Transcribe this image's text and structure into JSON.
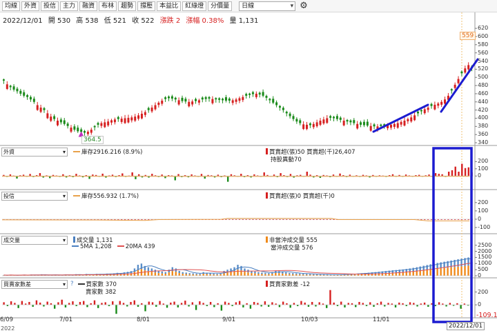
{
  "toolbar": {
    "buttons": [
      "均線",
      "外資",
      "投信",
      "主力",
      "融資",
      "布林",
      "趨勢",
      "撐壓",
      "本益比",
      "紅綠燈",
      "分價量"
    ],
    "period": "日線"
  },
  "quote": {
    "date": "2022/12/01",
    "open": "開 530",
    "high": "高 538",
    "low": "低 521",
    "close": "收 522",
    "change": "漲跌 2",
    "change_pct": "漲幅 0.38%",
    "volume": "量 1,131"
  },
  "colors": {
    "up": "#d62020",
    "down": "#1a8a1a",
    "accent_blue": "#1c1cd0",
    "ma": "#e8a14a"
  },
  "panels": {
    "foreign": {
      "select": "外資",
      "legend_hold": "庫存2916.216 (8.9%)",
      "legend_net": "買賣超(張)50 買賣超(千)26,407",
      "legend_sub": "持股異動70"
    },
    "trust": {
      "select": "投信",
      "legend_hold": "庫存556.932 (1.7%)",
      "legend_net": "買賣超(張)0 買賣超(千)0"
    },
    "volume": {
      "select": "成交量",
      "legend_vol": "成交量 1,131",
      "legend_ma5": "5MA 1,208",
      "legend_ma20": "20MA 439",
      "legend_day": "非當沖成交量 555",
      "legend_dt": "當沖成交量 576"
    },
    "brokers": {
      "select": "買賣家數差",
      "help": "?",
      "legend_buyers": "買家數 370",
      "legend_sellers": "賣家數 382",
      "legend_diff": "買賣家數差 -12",
      "last_value": "-109.1"
    }
  },
  "annotations": {
    "low_label": "364.5",
    "high_label": "559",
    "date_badge": "2022/12/01"
  },
  "x_ticks": [
    "6/09",
    "7/01",
    "8/01",
    "9/01",
    "10/03",
    "11/01"
  ],
  "x_year": "2022",
  "chart_data": [
    {
      "type": "candlestick",
      "title": "",
      "ylim": [
        335,
        632
      ],
      "yticks": [
        340,
        360,
        380,
        400,
        420,
        440,
        460,
        480,
        500,
        520,
        540,
        560,
        580,
        600,
        620
      ],
      "low": 364.5,
      "high": 559,
      "close_path": [
        492,
        483,
        476,
        470,
        466,
        460,
        455,
        452,
        446,
        440,
        432,
        426,
        420,
        412,
        404,
        398,
        394,
        390,
        386,
        381,
        377,
        372,
        368,
        366,
        364.5,
        367,
        372,
        378,
        384,
        388,
        390,
        392,
        395,
        397,
        398,
        399,
        400,
        401,
        402,
        404,
        407,
        411,
        415,
        420,
        426,
        432,
        438,
        443,
        447,
        449,
        448,
        446,
        444,
        442,
        441,
        440,
        441,
        442,
        444,
        446,
        447,
        448,
        447,
        446,
        445,
        444,
        443,
        443,
        444,
        446,
        449,
        452,
        455,
        457,
        459,
        460,
        458,
        455,
        450,
        444,
        438,
        432,
        426,
        420,
        412,
        405,
        398,
        392,
        388,
        385,
        384,
        383,
        386,
        390,
        394,
        397,
        400,
        401,
        400,
        398,
        396,
        394,
        392,
        390,
        388,
        386,
        384,
        383,
        382,
        381,
        380,
        380,
        381,
        382,
        383,
        384,
        386,
        388,
        391,
        394,
        398,
        402,
        407,
        412,
        417,
        422,
        426,
        430,
        433,
        436,
        440,
        446,
        455,
        468,
        482,
        496,
        510,
        522,
        530,
        522
      ]
    },
    {
      "type": "bar",
      "title": "外資",
      "yticks": [
        200,
        100,
        0
      ],
      "ylim": [
        -160,
        280
      ],
      "values": [
        15,
        -12,
        22,
        6,
        -35,
        10,
        18,
        -8,
        28,
        -14,
        12,
        40,
        -22,
        9,
        -30,
        15,
        7,
        -12,
        24,
        -20,
        10,
        -16,
        30,
        8,
        -18,
        12,
        -40,
        20,
        14,
        -10,
        32,
        -22,
        8,
        18,
        -14,
        12,
        36,
        -12,
        6,
        50,
        -44,
        24,
        -20,
        14,
        -22,
        30,
        10,
        -14,
        20,
        -30,
        12,
        8,
        -60,
        26,
        -16,
        12,
        -18,
        22,
        8,
        -12,
        28,
        -36,
        14,
        10,
        -20,
        18,
        -16,
        8,
        -80,
        24,
        10,
        -10,
        30,
        -16,
        12,
        -20,
        22,
        8,
        -12,
        50,
        14,
        -8,
        20,
        -16,
        40,
        12,
        -14,
        28,
        -22,
        10,
        16,
        -10,
        60,
        18,
        -20,
        12,
        -26,
        14,
        8,
        -16,
        20,
        -10,
        34,
        12,
        -14,
        18,
        -8,
        10,
        -12,
        16,
        8,
        -20,
        14,
        -10,
        10,
        6,
        -12,
        12,
        24,
        -8,
        14,
        -10,
        20,
        8,
        -6,
        12,
        16,
        -8,
        10,
        20,
        -10,
        40,
        30,
        24,
        -12,
        60,
        80,
        130,
        60,
        170,
        110,
        120,
        50
      ]
    },
    {
      "type": "bar",
      "title": "投信",
      "yticks": [
        200,
        100,
        0,
        -100
      ],
      "ylim": [
        -150,
        240
      ],
      "values": [
        0,
        0,
        0,
        0,
        0,
        0,
        0,
        0,
        0,
        0,
        0,
        0,
        0,
        0,
        0,
        0,
        0,
        0,
        0,
        0,
        0,
        0,
        0,
        0,
        0,
        0,
        0,
        0,
        0,
        0,
        0,
        0,
        0,
        0,
        0,
        0,
        0,
        0,
        0,
        0,
        0,
        0,
        0,
        0,
        0,
        0,
        0,
        0,
        0,
        0,
        0,
        0,
        0,
        0,
        0,
        0,
        0,
        0,
        0,
        0,
        0,
        0,
        0,
        0,
        0,
        0,
        0,
        0,
        0,
        0,
        0,
        0,
        0,
        0,
        0,
        0,
        0,
        0,
        0,
        0,
        0,
        0,
        0,
        0,
        0,
        0,
        0,
        0,
        0,
        0,
        0,
        0,
        0,
        0,
        0,
        0,
        0,
        0,
        0,
        0,
        0,
        0,
        0,
        0,
        0,
        0,
        0,
        0,
        0,
        0,
        0,
        0,
        0,
        0,
        0,
        0,
        0,
        0,
        0,
        0,
        0,
        0,
        0,
        0,
        0,
        0,
        0,
        0,
        0,
        0,
        0,
        0,
        0,
        0,
        0,
        0,
        0,
        0,
        0,
        0
      ]
    },
    {
      "type": "bar",
      "title": "成交量",
      "yticks": [
        2500,
        2000,
        1500,
        1000,
        500,
        0
      ],
      "ylim": [
        0,
        2650
      ],
      "values": [
        60,
        40,
        80,
        50,
        30,
        70,
        90,
        40,
        100,
        60,
        50,
        120,
        80,
        40,
        60,
        90,
        70,
        50,
        110,
        80,
        60,
        130,
        100,
        70,
        150,
        90,
        110,
        160,
        120,
        140,
        180,
        160,
        200,
        240,
        210,
        280,
        320,
        380,
        600,
        900,
        1000,
        800,
        700,
        600,
        500,
        400,
        350,
        300,
        500,
        700,
        600,
        400,
        300,
        260,
        220,
        200,
        180,
        160,
        300,
        250,
        200,
        180,
        160,
        220,
        400,
        500,
        600,
        700,
        900,
        800,
        600,
        500,
        400,
        350,
        300,
        260,
        240,
        220,
        300,
        420,
        380,
        320,
        280,
        240,
        220,
        200,
        180,
        160,
        150,
        140,
        130,
        120,
        110,
        100,
        90,
        80,
        90,
        100,
        110,
        120,
        130,
        150,
        170,
        190,
        210,
        230,
        250,
        280,
        300,
        330,
        360,
        390,
        420,
        450,
        470,
        500,
        520,
        560,
        600,
        650,
        700,
        760,
        820,
        880,
        940,
        1000,
        1050,
        1100,
        1150,
        1200,
        1250,
        1300,
        1350,
        1400,
        1450,
        1500,
        1131
      ]
    },
    {
      "type": "bar",
      "title": "買賣家數差",
      "yticks": [
        200,
        0
      ],
      "ylim": [
        -170,
        270
      ],
      "values": [
        40,
        -20,
        55,
        30,
        -50,
        60,
        20,
        45,
        -30,
        70,
        35,
        -25,
        50,
        25,
        -60,
        40,
        80,
        -40,
        30,
        55,
        -20,
        45,
        60,
        -35,
        25,
        70,
        -50,
        30,
        40,
        -20,
        55,
        -140,
        60,
        30,
        -25,
        45,
        70,
        -30,
        25,
        -100,
        50,
        40,
        -30,
        60,
        20,
        -45,
        35,
        50,
        -40,
        30,
        65,
        -25,
        40,
        -80,
        55,
        30,
        -20,
        45,
        -35,
        25,
        -90,
        50,
        30,
        -20,
        40,
        60,
        -40,
        25,
        -60,
        45,
        30,
        -25,
        55,
        -30,
        40,
        20,
        -35,
        50,
        25,
        -45,
        30,
        -20,
        60,
        35,
        -30,
        45,
        -25,
        40,
        20,
        -50,
        230,
        35,
        -20,
        50,
        -40,
        30,
        25,
        -35,
        45,
        30,
        -20,
        40,
        -30,
        25,
        50,
        -25,
        30,
        20,
        -40,
        35,
        25,
        -20,
        40,
        30,
        -25,
        20,
        35,
        -30,
        25,
        -20,
        40,
        20,
        -25,
        30,
        -15,
        25,
        -60,
        20,
        -12,
        -109.1
      ]
    }
  ]
}
